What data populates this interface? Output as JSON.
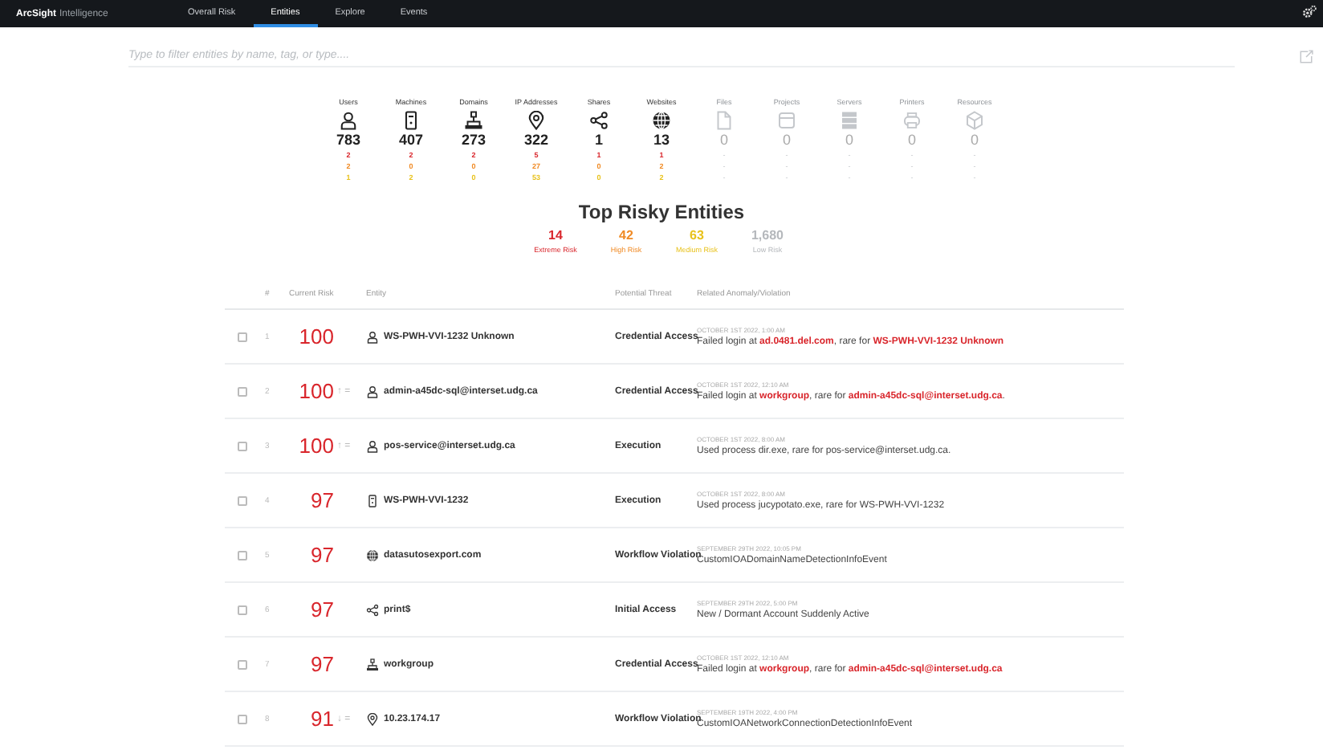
{
  "nav": {
    "brand": "ArcSight",
    "product": "Intelligence",
    "tabs": [
      {
        "label": "Overall Risk",
        "selected": false
      },
      {
        "label": "Entities",
        "selected": true
      },
      {
        "label": "Explore",
        "selected": false
      },
      {
        "label": "Events",
        "selected": false
      }
    ]
  },
  "filter": {
    "placeholder": "Type to filter entities by name, tag, or type...."
  },
  "stats": [
    {
      "kind": "user",
      "label": "Users",
      "disabled": false,
      "count": "783",
      "extreme": "2",
      "high": "2",
      "medium": "1"
    },
    {
      "kind": "machine",
      "label": "Machines",
      "disabled": false,
      "count": "407",
      "extreme": "2",
      "high": "0",
      "medium": "2"
    },
    {
      "kind": "domain",
      "label": "Domains",
      "disabled": false,
      "count": "273",
      "extreme": "2",
      "high": "0",
      "medium": "0"
    },
    {
      "kind": "ip",
      "label": "IP Addresses",
      "disabled": false,
      "count": "322",
      "extreme": "5",
      "high": "27",
      "medium": "53"
    },
    {
      "kind": "share",
      "label": "Shares",
      "disabled": false,
      "count": "1",
      "extreme": "1",
      "high": "0",
      "medium": "0"
    },
    {
      "kind": "website",
      "label": "Websites",
      "disabled": false,
      "count": "13",
      "extreme": "1",
      "high": "2",
      "medium": "2"
    },
    {
      "kind": "file",
      "label": "Files",
      "disabled": true,
      "count": "0",
      "extreme": "-",
      "high": "-",
      "medium": "-"
    },
    {
      "kind": "project",
      "label": "Projects",
      "disabled": true,
      "count": "0",
      "extreme": "-",
      "high": "-",
      "medium": "-"
    },
    {
      "kind": "server",
      "label": "Servers",
      "disabled": true,
      "count": "0",
      "extreme": "-",
      "high": "-",
      "medium": "-"
    },
    {
      "kind": "printer",
      "label": "Printers",
      "disabled": true,
      "count": "0",
      "extreme": "-",
      "high": "-",
      "medium": "-"
    },
    {
      "kind": "resource",
      "label": "Resources",
      "disabled": true,
      "count": "0",
      "extreme": "-",
      "high": "-",
      "medium": "-"
    }
  ],
  "summary": {
    "title": "Top Risky Entities",
    "levels": [
      {
        "count": "14",
        "label": "Extreme Risk",
        "color": "#d9262c"
      },
      {
        "count": "42",
        "label": "High Risk",
        "color": "#f08a24"
      },
      {
        "count": "63",
        "label": "Medium Risk",
        "color": "#e8c21c"
      },
      {
        "count": "1,680",
        "label": "Low Risk",
        "color": "#b5b8bc"
      }
    ]
  },
  "table": {
    "columns": [
      "#",
      "Current Risk",
      "Entity",
      "Potential Threat",
      "Related Anomaly/Violation"
    ],
    "rows": [
      {
        "checked": false,
        "index": "1",
        "risk": "100",
        "kind": "user",
        "entity": "WS-PWH-VVI-1232 Unknown",
        "threat": "Credential Access",
        "date": "OCTOBER 1ST 2022, 1:00 AM",
        "anomaly": "Failed login at **ad.0481.del.com**, rare for **WS-PWH-VVI-1232 Unknown**"
      },
      {
        "checked": false,
        "index": "2",
        "risk": "100",
        "trend": "↑ =",
        "kind": "user",
        "entity": "admin-a45dc-sql@interset.udg.ca",
        "threat": "Credential Access",
        "date": "OCTOBER 1ST 2022, 12:10 AM",
        "anomaly": "Failed login at **workgroup**, rare for **admin-a45dc-sql@interset.udg.ca**."
      },
      {
        "checked": false,
        "index": "3",
        "risk": "100",
        "trend": "↑ =",
        "kind": "user",
        "entity": "pos-service@interset.udg.ca",
        "threat": "Execution",
        "date": "OCTOBER 1ST 2022, 8:00 AM",
        "anomaly": "Used process dir.exe, rare for pos-service@interset.udg.ca."
      },
      {
        "checked": false,
        "index": "4",
        "risk": "97",
        "kind": "machine",
        "entity": "WS-PWH-VVI-1232",
        "threat": "Execution",
        "date": "OCTOBER 1ST 2022, 8:00 AM",
        "anomaly": "Used process jucypotato.exe, rare for WS-PWH-VVI-1232"
      },
      {
        "checked": false,
        "index": "5",
        "risk": "97",
        "kind": "website",
        "entity": "datasutosexport.com",
        "threat": "Workflow Violation",
        "date": "SEPTEMBER 29TH 2022, 10:05 PM",
        "anomaly": "CustomIOADomainNameDetectionInfoEvent"
      },
      {
        "checked": false,
        "index": "6",
        "risk": "97",
        "kind": "share",
        "entity": "print$",
        "threat": "Initial Access",
        "date": "SEPTEMBER 29TH 2022, 5:00 PM",
        "anomaly": "New / Dormant Account Suddenly Active"
      },
      {
        "checked": false,
        "index": "7",
        "risk": "97",
        "kind": "domain",
        "entity": "workgroup",
        "threat": "Credential Access",
        "date": "OCTOBER 1ST 2022, 12:10 AM",
        "anomaly": "Failed login at **workgroup**, rare for **admin-a45dc-sql@interset.udg.ca**"
      },
      {
        "checked": false,
        "index": "8",
        "risk": "91",
        "trend": "↓ =",
        "kind": "ip",
        "entity": "10.23.174.17",
        "threat": "Workflow Violation",
        "date": "SEPTEMBER 19TH 2022, 4:00 PM",
        "anomaly": "CustomIOANetworkConnectionDetectionInfoEvent"
      }
    ]
  }
}
